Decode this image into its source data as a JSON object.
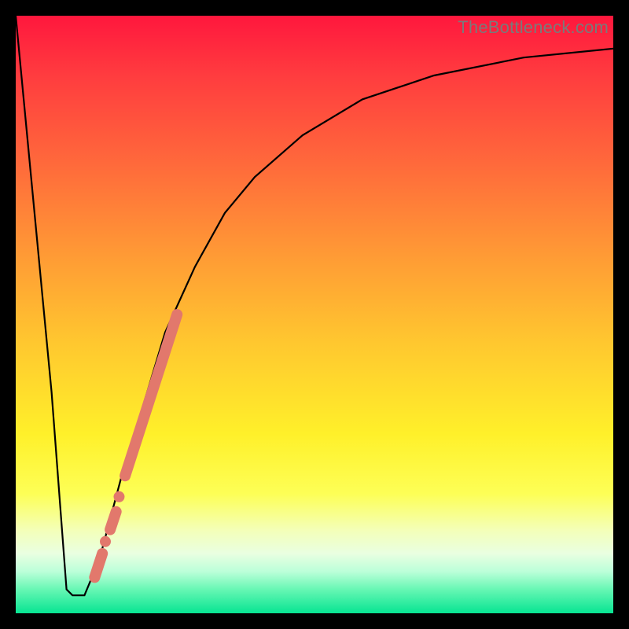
{
  "watermark": "TheBottleneck.com",
  "colors": {
    "frame": "#000000",
    "curve": "#000000",
    "overlay": "#e2786c"
  },
  "chart_data": {
    "type": "line",
    "title": "",
    "xlabel": "",
    "ylabel": "",
    "xlim": [
      0,
      100
    ],
    "ylim": [
      0,
      100
    ],
    "grid": false,
    "series": [
      {
        "name": "bottleneck-curve",
        "x": [
          0,
          6,
          8.5,
          9.5,
          11.5,
          14,
          18,
          22,
          25,
          30,
          35,
          40,
          48,
          58,
          70,
          85,
          100
        ],
        "values": [
          100,
          37,
          4,
          3,
          3,
          9,
          24,
          37,
          47,
          58,
          67,
          73,
          80,
          86,
          90,
          93,
          94.5
        ]
      }
    ],
    "overlay_segments": [
      {
        "x1": 13.2,
        "y1": 6,
        "x2": 14.5,
        "y2": 10
      },
      {
        "x1": 15.8,
        "y1": 14,
        "x2": 16.8,
        "y2": 17
      },
      {
        "x1": 18.3,
        "y1": 23,
        "x2": 27.0,
        "y2": 50
      }
    ],
    "overlay_dots": [
      {
        "x": 17.3,
        "y": 19.5,
        "r": 7
      },
      {
        "x": 15.0,
        "y": 12,
        "r": 7
      }
    ]
  }
}
